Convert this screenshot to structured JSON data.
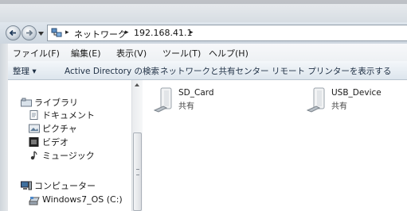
{
  "address": {
    "crumbs": [
      "ネットワーク",
      "192.168.41.1"
    ],
    "separator": "▸"
  },
  "menu": {
    "items": [
      "ファイル(F)",
      "編集(E)",
      "表示(V)",
      "ツール(T)",
      "ヘルプ(H)"
    ]
  },
  "toolbar": {
    "organize": "整理 ▾",
    "active_directory": "Active Directory の検索",
    "network_center": "ネットワークと共有センター",
    "remote_printer": "リモート プリンターを表示する"
  },
  "sidebar": {
    "libraries": "ライブラリ",
    "documents": "ドキュメント",
    "pictures": "ピクチャ",
    "videos": "ビデオ",
    "music": "ミュージック",
    "computer": "コンピューター",
    "drive": "Windows7_OS (C:)"
  },
  "shares": [
    {
      "name": "SD_Card",
      "type": "共有"
    },
    {
      "name": "USB_Device",
      "type": "共有"
    }
  ]
}
